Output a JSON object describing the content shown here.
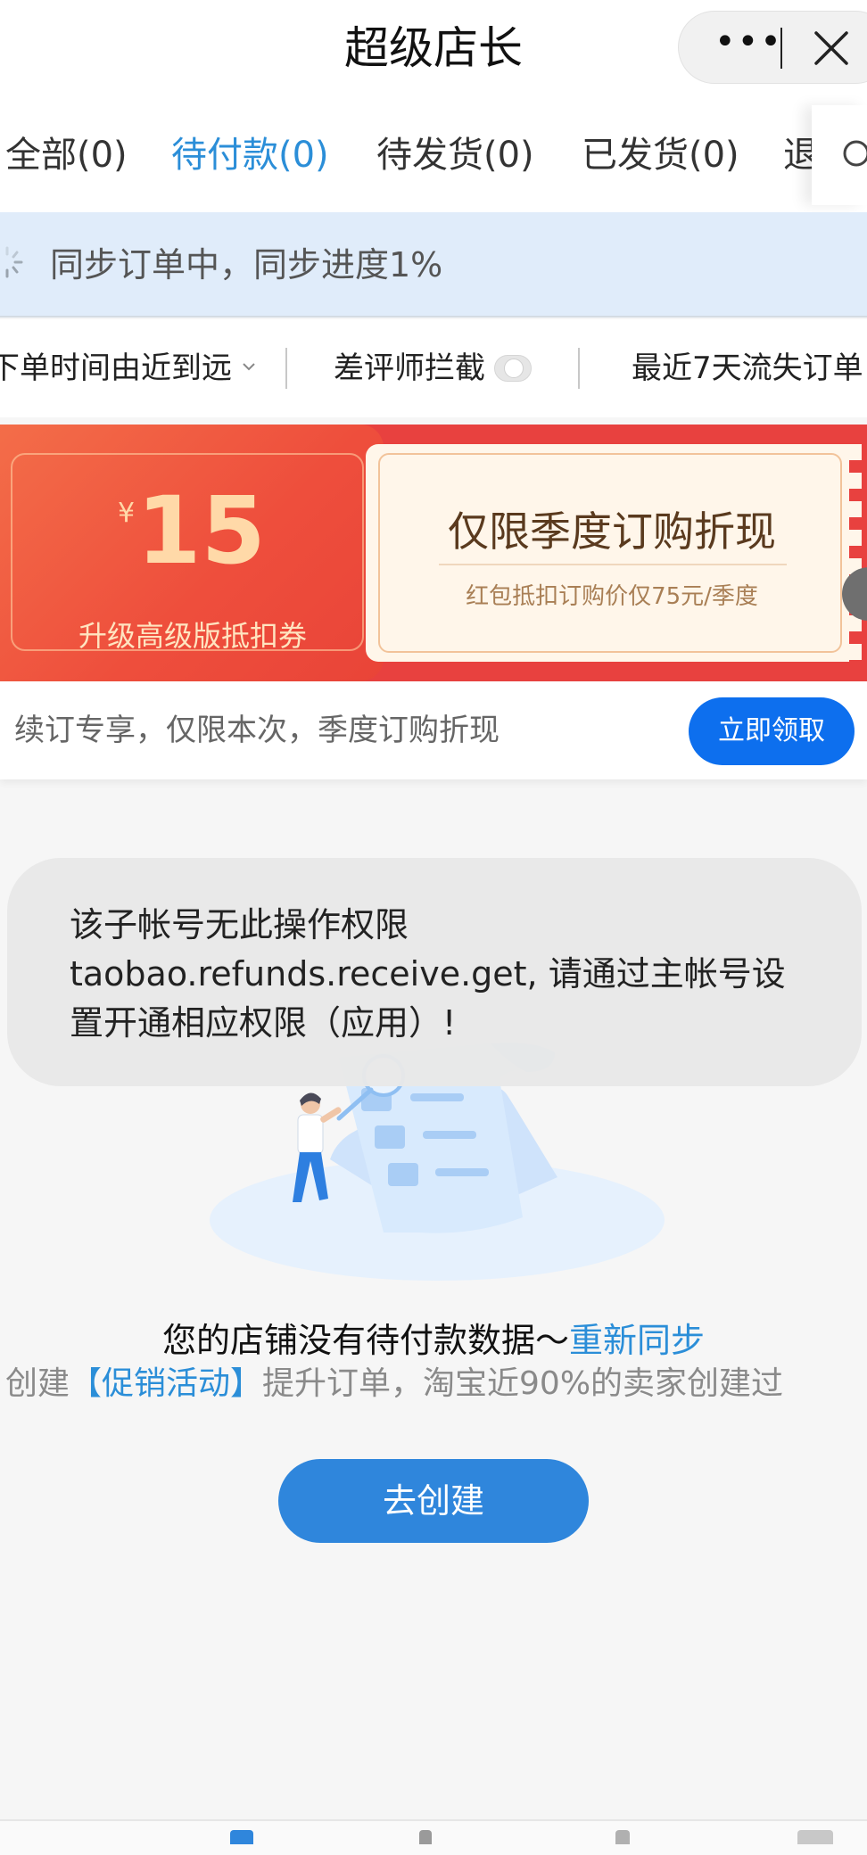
{
  "header": {
    "title": "超级店长",
    "more_glyph": "•••"
  },
  "tabs": [
    {
      "label": "全部(0)",
      "active": false
    },
    {
      "label": "待付款(0)",
      "active": true
    },
    {
      "label": "待发货(0)",
      "active": false
    },
    {
      "label": "已发货(0)",
      "active": false
    },
    {
      "label": "退",
      "active": false
    }
  ],
  "sync": {
    "text": "同步订单中，同步进度1%",
    "progress_percent": 1
  },
  "filters": {
    "sort_label": "下单时间由近到远",
    "bad_review_label": "差评师拦截",
    "bad_review_enabled": false,
    "lost_orders_label": "最近7天流失订单"
  },
  "promo": {
    "currency": "¥",
    "amount": "15",
    "coupon_name": "升级高级版抵扣券",
    "title": "仅限季度订购折现",
    "subtitle": "红包抵扣订购价仅75元/季度",
    "footer_text": "续订专享，仅限本次，季度订购折现",
    "claim_button": "立即领取"
  },
  "toast": {
    "lines": [
      "该子帐号无此操作权限",
      "taobao.refunds.receive.get, 请通过主帐号设",
      "置开通相应权限（应用）!"
    ]
  },
  "empty_state": {
    "message": "您的店铺没有待付款数据～",
    "resync_link": "重新同步",
    "promo_prefix": "创建",
    "promo_highlight": "【促销活动】",
    "promo_suffix": "提升订单，淘宝近90%的卖家创建过",
    "create_button": "去创建"
  },
  "colors": {
    "accent": "#2b8ed8",
    "claim_button": "#0d6fee",
    "promo_red": "#e8413f",
    "sync_bg": "#e0ecfa"
  }
}
